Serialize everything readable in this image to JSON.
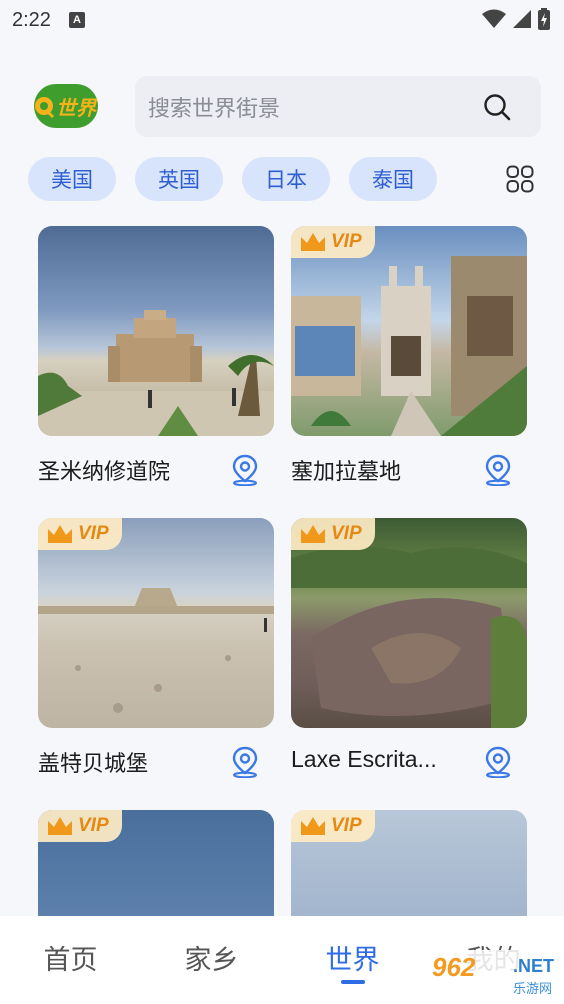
{
  "status_bar": {
    "time": "2:22",
    "notif_icon": "A"
  },
  "header": {
    "logo_text": "世界",
    "search": {
      "placeholder": "搜索世界街景"
    }
  },
  "categories": [
    "美国",
    "英国",
    "日本",
    "泰国"
  ],
  "cards": [
    {
      "title": "圣米纳修道院",
      "vip": false,
      "vip_label": ""
    },
    {
      "title": "塞加拉墓地",
      "vip": true,
      "vip_label": "VIP"
    },
    {
      "title": "盖特贝城堡",
      "vip": true,
      "vip_label": "VIP"
    },
    {
      "title": "Laxe Escrita...",
      "vip": true,
      "vip_label": "VIP"
    },
    {
      "title": "",
      "vip": true,
      "vip_label": "VIP"
    },
    {
      "title": "",
      "vip": true,
      "vip_label": "VIP"
    }
  ],
  "bottom_nav": {
    "items": [
      "首页",
      "家乡",
      "世界",
      "我的"
    ],
    "active": "世界"
  },
  "watermark": {
    "main": "962",
    "net": ".NET",
    "sub": "乐游网"
  },
  "colors": {
    "accent": "#2e6be6",
    "chip_bg": "#d8e4fb",
    "vip": "#e48a12",
    "logo_green": "#3f9d2e",
    "logo_yellow": "#f5b21b"
  }
}
